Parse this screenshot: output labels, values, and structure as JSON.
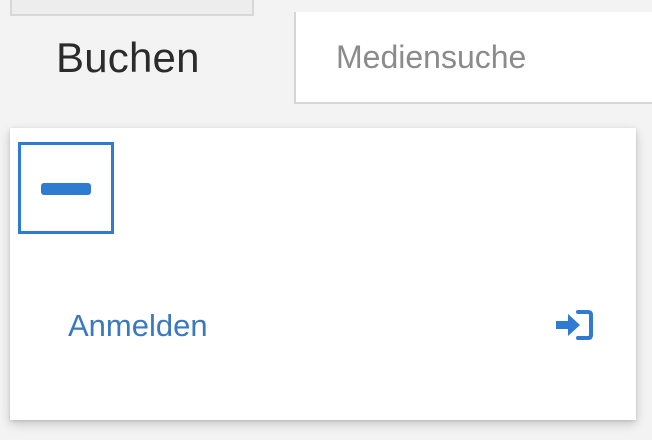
{
  "tabs": {
    "buchen_label": "Buchen",
    "mediensuche_label": "Mediensuche"
  },
  "panel": {
    "collapse_icon": "minus-icon",
    "login_label": "Anmelden",
    "login_icon": "sign-in-icon"
  },
  "colors": {
    "accent": "#2f7bd1",
    "link": "#3a78c0",
    "tab_active_text": "#2b2b2b",
    "tab_inactive_text": "#8b8b8b"
  }
}
